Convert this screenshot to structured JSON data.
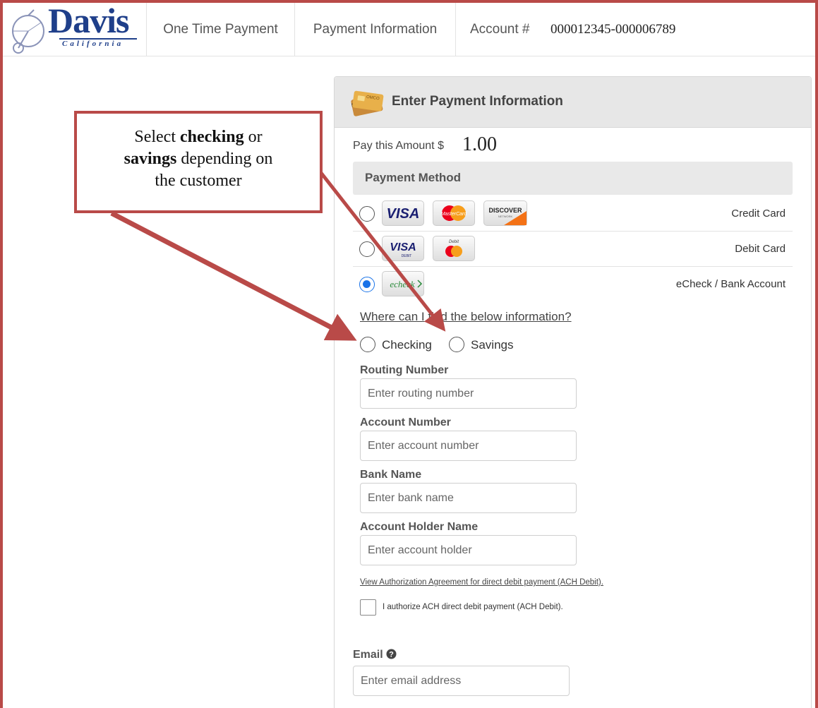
{
  "nav": {
    "logo_text": "Davis",
    "logo_sub": "California",
    "items": [
      "One Time Payment",
      "Payment Information"
    ],
    "account_label": "Account #",
    "account_number": "000012345-000006789"
  },
  "card": {
    "title": "Enter Payment Information",
    "amount_label": "Pay this Amount $",
    "amount_value": "1.00",
    "method_header": "Payment Method",
    "methods": [
      {
        "type": "Credit Card",
        "selected": false,
        "logos": [
          "VISA",
          "MasterCard",
          "DISCOVER"
        ]
      },
      {
        "type": "Debit Card",
        "selected": false,
        "logos": [
          "VISA DEBIT",
          "Debit MasterCard"
        ]
      },
      {
        "type": "eCheck / Bank Account",
        "selected": true,
        "logos": [
          "echeck"
        ]
      }
    ],
    "help_link": "Where can I find the below information?",
    "account_types": [
      {
        "label": "Checking",
        "selected": false
      },
      {
        "label": "Savings",
        "selected": false
      }
    ],
    "fields": [
      {
        "label": "Routing Number",
        "placeholder": "Enter routing number"
      },
      {
        "label": "Account Number",
        "placeholder": "Enter account number"
      },
      {
        "label": "Bank Name",
        "placeholder": "Enter bank name"
      },
      {
        "label": "Account Holder Name",
        "placeholder": "Enter account holder"
      }
    ],
    "auth_link": "View Authorization Agreement for direct debit payment (ACH Debit).",
    "auth_checkbox_label": "I authorize ACH direct debit payment (ACH Debit).",
    "email_label": "Email",
    "email_placeholder": "Enter email address"
  },
  "callout": {
    "line1_a": "Select ",
    "line1_b": "checking",
    "line1_c": " or",
    "line2_a": "savings",
    "line2_b": " depending on",
    "line3": "the customer"
  },
  "colors": {
    "annotation": "#b94a48",
    "brand": "#1f3f8a",
    "radio_selected": "#1a73e8"
  }
}
